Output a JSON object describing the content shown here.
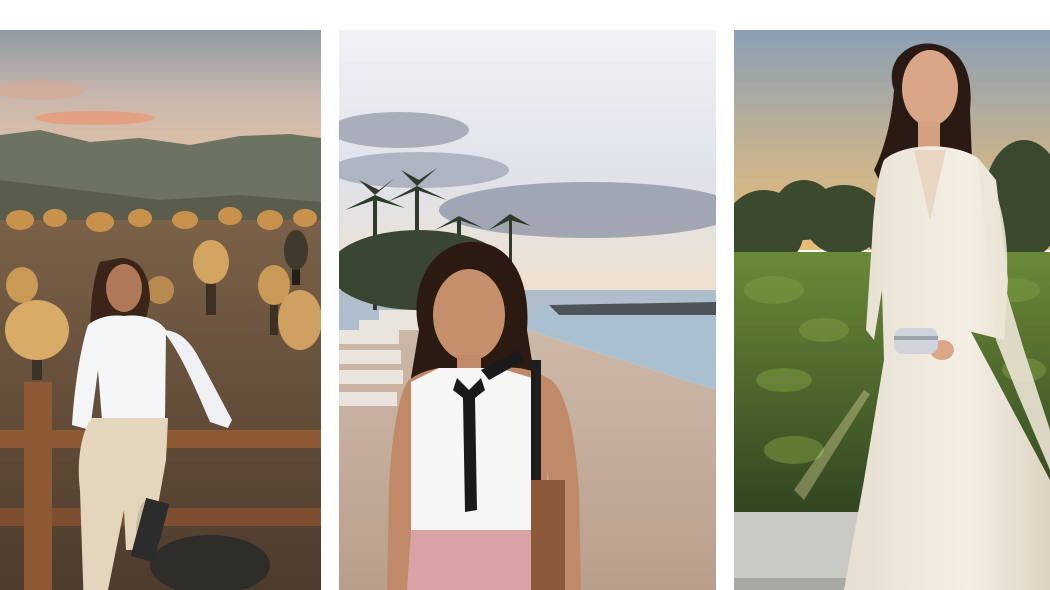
{
  "collage": {
    "background": "#ffffff",
    "photos": [
      {
        "subject": "woman-in-desert",
        "palette": {
          "sky_top": "#9aa3a8",
          "sky_glow": "#e9b38a",
          "mountain": "#6f7560",
          "ground": "#8a6a4c",
          "cactus": "#c99a55",
          "fence": "#8e5a36",
          "shirt": "#f4f5f7",
          "pants": "#e4d6bd",
          "hair": "#3a2518"
        }
      },
      {
        "subject": "woman-on-beach",
        "palette": {
          "sky_top": "#dfe4ee",
          "cloud": "#8e96a6",
          "sea": "#9fb7c8",
          "sand": "#c7b0a0",
          "palm": "#2f3a2c",
          "blouse": "#f6f6f4",
          "skirt": "#d9a3a6",
          "hair": "#2b1a12",
          "bag": "#8a5a3a"
        }
      },
      {
        "subject": "woman-in-white-gown",
        "palette": {
          "sky_top": "#8fa3b6",
          "sky_glow": "#e2b978",
          "trees": "#3b4a2e",
          "hedge": "#5e7a32",
          "gown": "#f1ebdf",
          "hair": "#2a1a14",
          "clutch": "#cfd4dc"
        }
      }
    ]
  }
}
